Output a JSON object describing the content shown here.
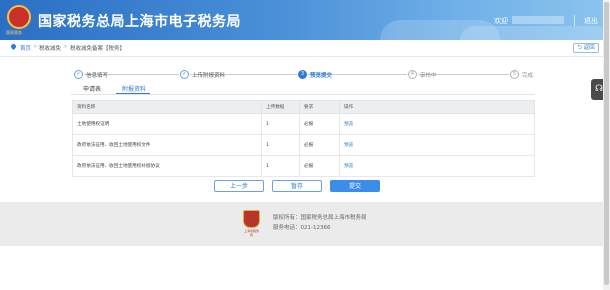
{
  "header": {
    "site_title": "国家税务总局上海市电子税务局",
    "emblem_caption": "国家税务",
    "welcome": "欢迎",
    "logout": "退出"
  },
  "breadcrumb": {
    "home": "首页",
    "sep": ">",
    "level1": "税收减免",
    "level2": "税收减免备案【税务】"
  },
  "back_button": "返回",
  "steps": [
    {
      "num": "✓",
      "label": "信息填写",
      "state": "done"
    },
    {
      "num": "✓",
      "label": "上传附报资料",
      "state": "done"
    },
    {
      "num": "3",
      "label": "预览提交",
      "state": "current"
    },
    {
      "num": "4",
      "label": "审核中",
      "state": "pending"
    },
    {
      "num": "5",
      "label": "完成",
      "state": "pending"
    }
  ],
  "tabs": [
    {
      "label": "申请表"
    },
    {
      "label": "附报资料"
    }
  ],
  "table": {
    "headers": [
      "资料名称",
      "上传数据",
      "要求",
      "操作"
    ],
    "rows": [
      {
        "name": "土地使用权证明",
        "count": "1",
        "req": "必报",
        "action": "预览"
      },
      {
        "name": "政府依法征用、收回土地使用权文件",
        "count": "1",
        "req": "必报",
        "action": "预览"
      },
      {
        "name": "政府依法征用、收回土地使用权补偿协议",
        "count": "1",
        "req": "必报",
        "action": "预览"
      }
    ]
  },
  "buttons": {
    "prev": "上一步",
    "save": "暂存",
    "submit": "提交"
  },
  "footer": {
    "copyright": "版权所有：国家税务总局上海市税务局",
    "phone": "服务电话：021-12366",
    "logo_caption": "上海市税务局"
  },
  "colors": {
    "accent": "#2d7bd4",
    "header_start": "#2a6fc4",
    "submit_bg": "#3a8de8"
  }
}
